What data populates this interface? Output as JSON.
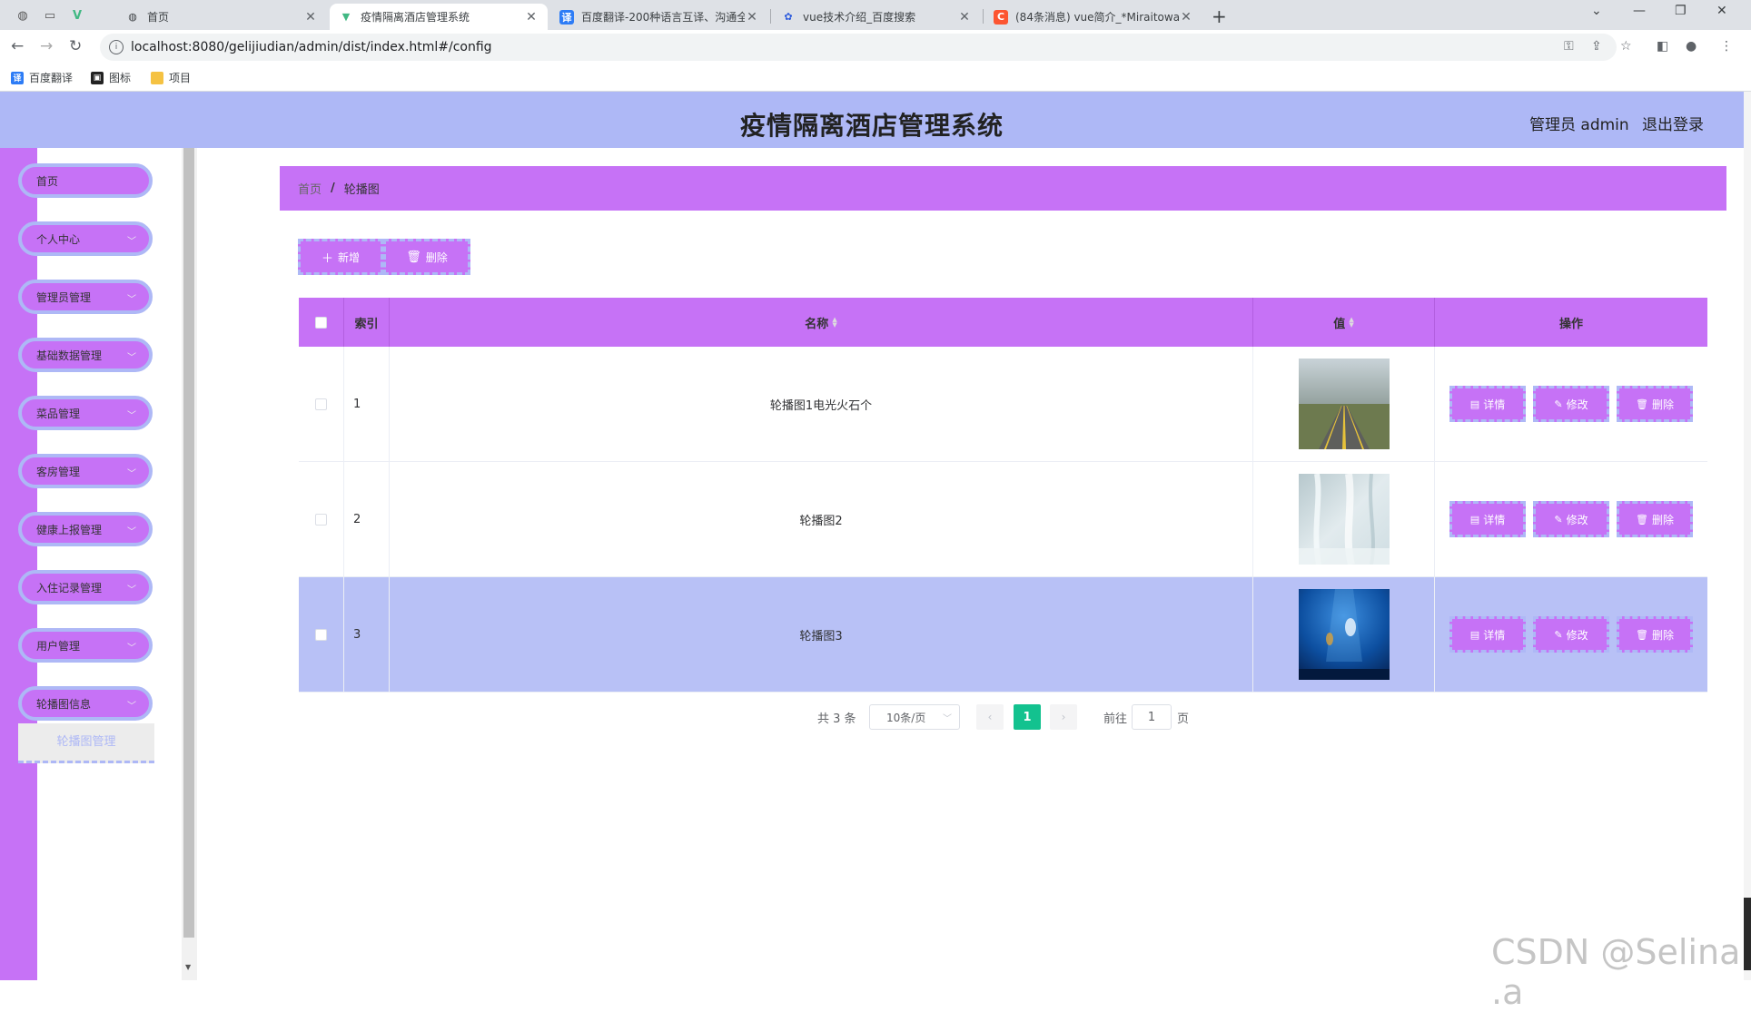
{
  "browser": {
    "tabs": [
      {
        "title": "首页",
        "favicon": "globe-icon"
      },
      {
        "title": "疫情隔离酒店管理系统",
        "favicon": "vue-icon",
        "active": true
      },
      {
        "title": "百度翻译-200种语言互译、沟通全",
        "favicon": "translate-icon"
      },
      {
        "title": "vue技术介绍_百度搜索",
        "favicon": "baidu-paw-icon"
      },
      {
        "title": "(84条消息) vue简介_*Miraitowa",
        "favicon": "csdn-icon"
      }
    ],
    "url": "localhost:8080/gelijiudian/admin/dist/index.html#/config",
    "bookmarks": [
      {
        "label": "百度翻译",
        "icon": "translate-icon"
      },
      {
        "label": "图标",
        "icon": "image-icon"
      },
      {
        "label": "项目",
        "icon": "folder-icon"
      }
    ]
  },
  "header": {
    "title": "疫情隔离酒店管理系统",
    "user": "管理员 admin",
    "logout": "退出登录",
    "bg_color": "#aeb8f6"
  },
  "sidebar": {
    "items": [
      {
        "label": "首页",
        "expandable": false
      },
      {
        "label": "个人中心",
        "expandable": true
      },
      {
        "label": "管理员管理",
        "expandable": true
      },
      {
        "label": "基础数据管理",
        "expandable": true
      },
      {
        "label": "菜品管理",
        "expandable": true
      },
      {
        "label": "客房管理",
        "expandable": true
      },
      {
        "label": "健康上报管理",
        "expandable": true
      },
      {
        "label": "入住记录管理",
        "expandable": true
      },
      {
        "label": "用户管理",
        "expandable": true
      },
      {
        "label": "轮播图信息",
        "expandable": true
      }
    ],
    "subitem": "轮播图管理",
    "accent_color": "#c672f6"
  },
  "breadcrumb": {
    "home": "首页",
    "separator": "/",
    "current": "轮播图"
  },
  "toolbar": {
    "add_label": "新增",
    "delete_label": "删除"
  },
  "table": {
    "headers": {
      "index": "索引",
      "name": "名称",
      "value": "值",
      "actions": "操作"
    },
    "rows": [
      {
        "index": "1",
        "name": "轮播图1电光火石个",
        "image": "road-landscape",
        "highlighted": false
      },
      {
        "index": "2",
        "name": "轮播图2",
        "image": "frosted-waterfall",
        "highlighted": false
      },
      {
        "index": "3",
        "name": "轮播图3",
        "image": "underwater-fish",
        "highlighted": true
      }
    ],
    "row_actions": {
      "detail": "详情",
      "edit": "修改",
      "delete": "删除"
    }
  },
  "pagination": {
    "total_text": "共 3 条",
    "page_size": "10条/页",
    "current_page": "1",
    "goto_prefix": "前往",
    "goto_value": "1",
    "goto_suffix": "页",
    "active_color": "#13c28f"
  },
  "watermark": "CSDN @Selina .a"
}
